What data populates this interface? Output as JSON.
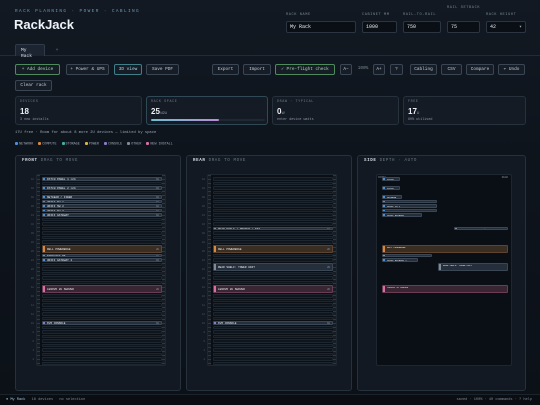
{
  "header": {
    "subtitle": "RACK PLANNING · POWER · CABLING",
    "title": "RackJack",
    "fields": [
      {
        "label": "RACK NAME",
        "value": "My Rack"
      },
      {
        "label": "CABINET MM",
        "value": "1000"
      },
      {
        "label": "RAIL-TO-RAIL",
        "value": "750"
      },
      {
        "label": "RAIL SETBACK",
        "value": "75"
      },
      {
        "label": "RACK HEIGHT",
        "value": "42"
      }
    ]
  },
  "tabs": [
    {
      "label": "My Rack"
    },
    {
      "label": "+"
    }
  ],
  "toolbar": {
    "left": [
      "+ Add device",
      "+ Power & UPS",
      "3D view",
      "Save PDF"
    ],
    "right": [
      "Export",
      "Import",
      "✓ Pre-flight check",
      "A−",
      "100%",
      "A+",
      "?",
      "Cabling",
      "CSV",
      "Compare",
      "↶ Undo"
    ],
    "clear": "Clear rack"
  },
  "cards": [
    {
      "label": "DEVICES",
      "value": "18",
      "unit": "",
      "sub": "3 new installs"
    },
    {
      "label": "RACK SPACE",
      "value": "25",
      "unit": "/42U",
      "sub": "",
      "fill": 0.595
    },
    {
      "label": "DRAW · TYPICAL",
      "value": "0",
      "unit": "W",
      "sub": "enter device watts"
    },
    {
      "label": "FREE",
      "value": "17",
      "unit": "U",
      "sub": "60% utilised"
    }
  ],
  "info": "17U free · Room for about 8 more 2U devices — limited by space",
  "legend": [
    {
      "label": "NETWORK",
      "color": "#4c8ed8"
    },
    {
      "label": "COMPUTE",
      "color": "#d3893e"
    },
    {
      "label": "STORAGE",
      "color": "#3fb0a4"
    },
    {
      "label": "POWER",
      "color": "#d8b64a"
    },
    {
      "label": "CONSOLE",
      "color": "#8d78c9"
    },
    {
      "label": "OTHER",
      "color": "#7f8a96"
    },
    {
      "label": "NEW INSTALL",
      "color": "#d86ea3"
    }
  ],
  "panels": [
    {
      "title": "FRONT",
      "hint": "DRAG TO MOVE"
    },
    {
      "title": "REAR",
      "hint": "DRAG TO MOVE"
    },
    {
      "title": "SIDE",
      "hint": "DEPTH · AUTO"
    }
  ],
  "front_devices": [
    {
      "label": "PATCH PANEL 1 ×24",
      "cat": "net",
      "u": 42,
      "tag": "1U"
    },
    {
      "label": "PATCH PANEL 2 ×24",
      "cat": "net",
      "u": 40,
      "tag": "1U"
    },
    {
      "label": "NETGEAR / FIBER",
      "cat": "net",
      "u": 38,
      "tag": "1U"
    },
    {
      "label": "UNIFI SW 1",
      "cat": "net",
      "u": 37,
      "tag": "1U"
    },
    {
      "label": "UNIFI SW 2",
      "cat": "net",
      "u": 36,
      "tag": "1U"
    },
    {
      "label": "UNIFI SW 3",
      "cat": "net",
      "u": 35,
      "tag": "1U"
    },
    {
      "label": "UNIFI GATEWAY",
      "cat": "net",
      "u": 34,
      "tag": "1U"
    },
    {
      "label": "DELL POWEREDGE",
      "cat": "comp",
      "u": 27,
      "tag": "2U"
    },
    {
      "label": "SYNOLOGY RS",
      "cat": "stor",
      "u": 25,
      "tag": "1U"
    },
    {
      "label": "UNIFI GATEWAY 2",
      "cat": "net",
      "u": 24,
      "tag": "1U"
    },
    {
      "label": "LENOVO 2U SERVER",
      "cat": "new",
      "u": 18,
      "tag": "2U"
    },
    {
      "label": "KVM CONSOLE",
      "cat": "con",
      "u": 10,
      "tag": "1U"
    }
  ],
  "rear_devices": [
    {
      "label": "REAR SHELF / ROUTER / NAT",
      "cat": "oth",
      "u": 31,
      "tag": "1U"
    },
    {
      "label": "DELL POWEREDGE",
      "cat": "comp",
      "u": 27,
      "tag": "2U"
    },
    {
      "label": "REAR SHELF: TOWER UNIT",
      "cat": "oth",
      "u": 23,
      "tag": "2U"
    },
    {
      "label": "LENOVO 2U SERVER",
      "cat": "new",
      "u": 18,
      "tag": "2U"
    },
    {
      "label": "KVM CONSOLE",
      "cat": "con",
      "u": 10,
      "tag": "1U"
    }
  ],
  "side_labels": {
    "rear": "REAR",
    "front": "FRONT",
    "items": [
      "PATCH",
      "PATCH",
      "NETGEAR",
      "UNIFI SW 1",
      "UNIFI SW 2",
      "UNIFI SW 3",
      "UNIFI GATEWAY",
      "REAR SHELF: ROUTER / NAT",
      "DELL POWEREDGE",
      "SYNOLOGY",
      "UNIFI GATEWAY 2",
      "REAR SHELF: TOWER UNIT",
      "LENOVO 2U SERVER"
    ]
  },
  "status": {
    "left": "● My Rack",
    "mid": "18 devices",
    "sel": "no selection",
    "right": "saved · 100% · 40 commands · ? help"
  }
}
